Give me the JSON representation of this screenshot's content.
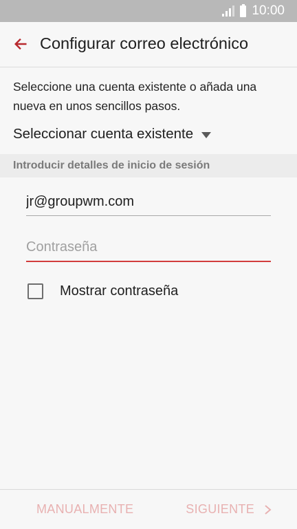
{
  "status_bar": {
    "time": "10:00",
    "signal_icon": "signal-icon",
    "battery_icon": "battery-icon"
  },
  "app_bar": {
    "title": "Configurar correo electrónico",
    "back_icon": "arrow-back-icon",
    "accent_color": "#b8282e"
  },
  "intro_text": "Seleccione una cuenta existente o añada una nueva en unos sencillos pasos.",
  "account_select": {
    "label": "Seleccionar cuenta existente",
    "icon": "dropdown-caret-icon"
  },
  "section_header": "Introducir detalles de inicio de sesión",
  "form": {
    "email_value": "jr@groupwm.com",
    "password_placeholder": "Contraseña",
    "show_password_label": "Mostrar contraseña",
    "show_password_checked": false
  },
  "bottom_bar": {
    "manual_label": "MANUALMENTE",
    "next_label": "SIGUIENTE",
    "next_icon": "chevron-right-icon",
    "disabled_color": "#e8b1b1"
  }
}
